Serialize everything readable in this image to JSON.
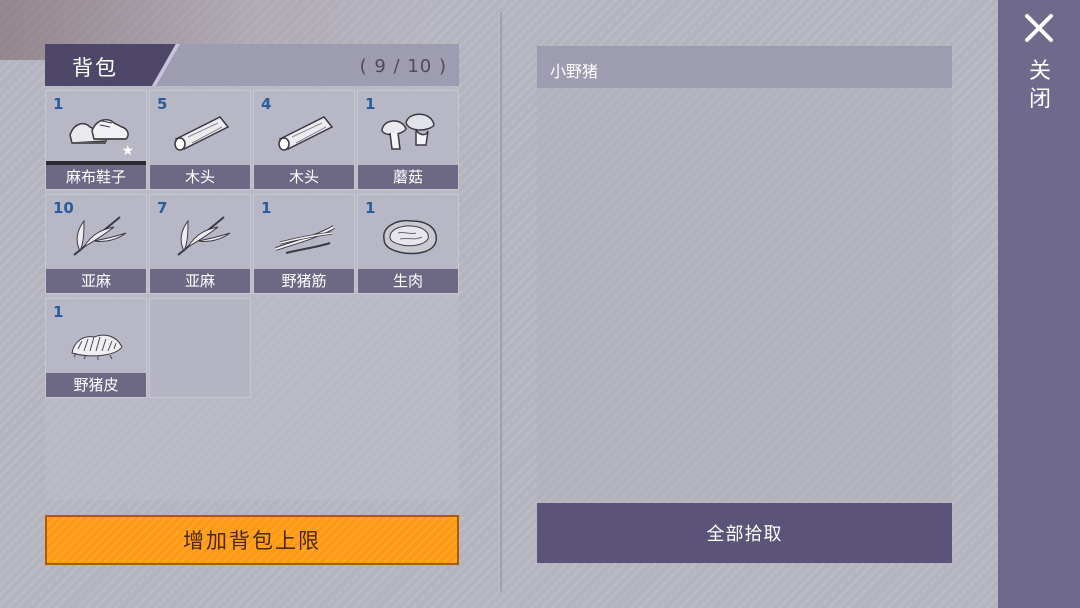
{
  "backpack": {
    "title": "背包",
    "capacity": "( 9 / 10 )",
    "slots": [
      {
        "count": "1",
        "name": "麻布鞋子",
        "icon": "shoes-icon",
        "equipped": true
      },
      {
        "count": "5",
        "name": "木头",
        "icon": "log-icon"
      },
      {
        "count": "4",
        "name": "木头",
        "icon": "log-icon"
      },
      {
        "count": "1",
        "name": "蘑菇",
        "icon": "mushroom-icon"
      },
      {
        "count": "10",
        "name": "亚麻",
        "icon": "flax-icon"
      },
      {
        "count": "7",
        "name": "亚麻",
        "icon": "flax-icon"
      },
      {
        "count": "1",
        "name": "野猪筋",
        "icon": "sinew-icon"
      },
      {
        "count": "1",
        "name": "生肉",
        "icon": "meat-icon"
      },
      {
        "count": "1",
        "name": "野猪皮",
        "icon": "hide-icon"
      }
    ],
    "expand_label": "增加背包上限"
  },
  "loot": {
    "title": "小野猪",
    "pickup_all_label": "全部拾取"
  },
  "rail": {
    "close_label": "关闭"
  },
  "colors": {
    "panel_header": "#9d9cb0",
    "tab": "#4e4767",
    "label_bar": "#6d6884",
    "count_text": "#2b5c9a",
    "expand_button": "#ff9a12",
    "pickup_button": "#5b5378",
    "rail": "#6f6a8b"
  }
}
